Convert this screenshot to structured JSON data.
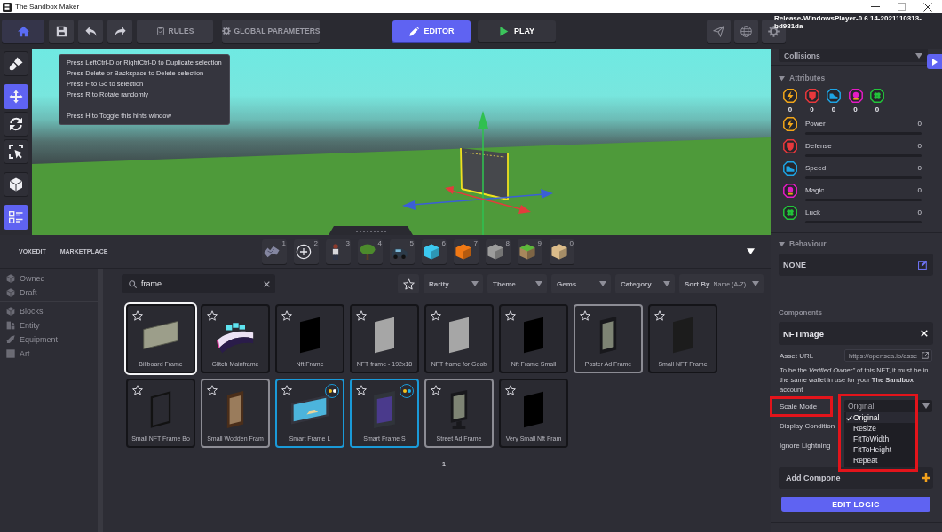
{
  "window": {
    "title": "The Sandbox Maker",
    "build": "Release-WindowsPlayer-0.6.14-2021110313-bd981da"
  },
  "toolbar": {
    "left": [
      {
        "kind": "home"
      },
      {
        "kind": "save"
      },
      {
        "kind": "undo"
      },
      {
        "kind": "redo"
      },
      {
        "kind": "rules",
        "label": "RULES"
      },
      {
        "kind": "gear",
        "label": "GLOBAL PARAMETERS"
      }
    ],
    "modes": [
      {
        "kind": "edit",
        "label": "EDITOR",
        "selected": true
      },
      {
        "kind": "play",
        "label": "PLAY",
        "selected": false
      }
    ],
    "right": [
      {
        "kind": "send"
      },
      {
        "kind": "globe"
      },
      {
        "kind": "settings"
      }
    ]
  },
  "tools": [
    [
      {
        "kind": "brush",
        "selected": false
      }
    ],
    [
      {
        "kind": "move",
        "selected": true
      },
      {
        "kind": "rotate",
        "selected": false
      },
      {
        "kind": "select",
        "selected": false
      }
    ],
    [
      {
        "kind": "cube",
        "selected": false
      }
    ],
    [
      {
        "kind": "hints",
        "selected": true
      }
    ]
  ],
  "hints": {
    "lines": [
      "Press LeftCtrl-D or RightCtrl-D to Duplicate selection",
      "Press Delete or Backspace to Delete selection",
      "Press F to Go to selection",
      "Press R to Rotate randomly"
    ],
    "footer": "Press H to Toggle this hints window"
  },
  "library": {
    "tabs": [
      {
        "label": "VOXEDIT"
      },
      {
        "label": "MARKETPLACE"
      }
    ],
    "quickbar": [
      {
        "number": "1",
        "kind": "creature"
      },
      {
        "number": "2",
        "kind": "add"
      },
      {
        "number": "3",
        "kind": "figure"
      },
      {
        "number": "4",
        "kind": "tree"
      },
      {
        "number": "5",
        "kind": "vehicle"
      },
      {
        "number": "6",
        "kind": "block",
        "color": "#3cc8f0"
      },
      {
        "number": "7",
        "kind": "block",
        "color": "#f07814"
      },
      {
        "number": "8",
        "kind": "block",
        "color": "#9c9c9c"
      },
      {
        "number": "9",
        "kind": "grass",
        "color": "#5cb83a"
      },
      {
        "number": "0",
        "kind": "block",
        "color": "#dcbc8a"
      }
    ],
    "categories": [
      {
        "items": [
          {
            "label": "Owned",
            "kind": "cube",
            "selected": false
          },
          {
            "label": "Draft",
            "kind": "cube",
            "selected": false
          }
        ]
      },
      {
        "items": [
          {
            "label": "Blocks",
            "kind": "cube",
            "selected": false
          },
          {
            "label": "Entity",
            "kind": "entity",
            "selected": false
          },
          {
            "label": "Equipment",
            "kind": "equipment",
            "selected": false
          },
          {
            "label": "Art",
            "kind": "art",
            "selected": false
          }
        ]
      }
    ],
    "search": {
      "value": "frame"
    },
    "filters": [
      {
        "label": "Rarity"
      },
      {
        "label": "Theme"
      },
      {
        "label": "Gems"
      },
      {
        "label": "Category"
      },
      {
        "label": "Sort By",
        "value": "Name (A-Z)"
      }
    ],
    "cards": [
      {
        "label": "Billboard Frame",
        "selected": true,
        "color": "#141418",
        "art": {
          "kind": "billboard",
          "color": "#9c9e8a"
        }
      },
      {
        "label": "Glitch Mainframe",
        "selected": false,
        "color": "#141418",
        "art": {
          "kind": "mainframe",
          "color": "#ece2f4"
        }
      },
      {
        "label": "Nft Frame",
        "selected": false,
        "color": "#141418",
        "art": {
          "kind": "panel",
          "color": "#000000"
        }
      },
      {
        "label": "NFT frame - 192x18",
        "selected": false,
        "color": "#141418",
        "art": {
          "kind": "panel",
          "color": "#a6a6a6"
        }
      },
      {
        "label": "NFT frame for Goob",
        "selected": false,
        "color": "#141418",
        "art": {
          "kind": "panel",
          "color": "#a6a6a6"
        }
      },
      {
        "label": "Nft Frame Small",
        "selected": false,
        "color": "#141418",
        "art": {
          "kind": "panel",
          "color": "#000000"
        }
      },
      {
        "label": "Poster Ad Frame",
        "selected": false,
        "color": "#8c8c94",
        "art": {
          "kind": "poster",
          "color": "#7e8474"
        }
      },
      {
        "label": "Small NFT Frame",
        "selected": false,
        "color": "#141418",
        "art": {
          "kind": "panel",
          "color": "#1c1c1c"
        }
      },
      {
        "label": "Small NFT Frame Bo",
        "selected": false,
        "color": "#141418",
        "art": {
          "kind": "outline",
          "color": "#121212"
        }
      },
      {
        "label": "Small Wodden Fram",
        "selected": false,
        "color": "#8c8c94",
        "art": {
          "kind": "wood",
          "color": "#9a7c5c"
        }
      },
      {
        "label": "Smart Frame L",
        "selected": false,
        "color": "#1a9ad8",
        "art": {
          "kind": "landscape",
          "color": "#4cb4dc"
        },
        "badge": [
          {
            "color": "#f2c21c"
          },
          {
            "color": "#ffffff"
          }
        ]
      },
      {
        "label": "Smart Frame S",
        "selected": false,
        "color": "#1a9ad8",
        "art": {
          "kind": "portrait",
          "color": "#4a3a8c"
        },
        "badge": [
          {
            "color": "#f2c21c"
          },
          {
            "color": "#18b4f0"
          }
        ]
      },
      {
        "label": "Street Ad Frame",
        "selected": false,
        "color": "#8c8c94",
        "art": {
          "kind": "sign",
          "color": "#7e8474"
        }
      },
      {
        "label": "Very Small Nft Fram",
        "selected": false,
        "color": "#141418",
        "art": {
          "kind": "panel",
          "color": "#000000"
        }
      }
    ],
    "page": "1"
  },
  "inspector": {
    "collisions": {
      "label": "Collisions"
    },
    "attributes": {
      "title": "Attributes",
      "expanded": true,
      "totals": [
        {
          "kind": "power",
          "value": "0",
          "color": "#f2a61a"
        },
        {
          "kind": "defense",
          "value": "0",
          "color": "#e8383c"
        },
        {
          "kind": "speed",
          "value": "0",
          "color": "#1ea4e4"
        },
        {
          "kind": "magic",
          "value": "0",
          "color": "#e41cc4"
        },
        {
          "kind": "luck",
          "value": "0",
          "color": "#22c43a"
        }
      ],
      "stats": [
        {
          "kind": "power",
          "name": "Power",
          "value": "0",
          "level": 0,
          "color": "#f2a61a"
        },
        {
          "kind": "defense",
          "name": "Defense",
          "value": "0",
          "level": 0,
          "color": "#e8383c"
        },
        {
          "kind": "speed",
          "name": "Speed",
          "value": "0",
          "level": 0,
          "color": "#1ea4e4"
        },
        {
          "kind": "magic",
          "name": "Magic",
          "value": "0",
          "level": 0,
          "color": "#e41cc4"
        },
        {
          "kind": "luck",
          "name": "Luck",
          "value": "0",
          "level": 0,
          "color": "#22c43a"
        }
      ]
    },
    "behaviour": {
      "title": "Behaviour",
      "expanded": true,
      "value": "NONE"
    },
    "components": {
      "title": "Components",
      "items": [
        {
          "name": "NFTImage",
          "fields": [
            {
              "kind": "url",
              "label": "Asset URL",
              "value": "https://opensea.io/asse"
            },
            {
              "kind": "note",
              "text": "To be the *Verified Owner\"* of this NFT, it must be in the same wallet in use for your **The Sandbox** account"
            },
            {
              "kind": "dropdown",
              "label": "Scale Mode",
              "value": "Original",
              "label_highlighted": true,
              "menu_highlighted": true,
              "open": true,
              "options": [
                {
                  "label": "Original",
                  "selected": true
                },
                {
                  "label": "Resize",
                  "selected": false
                },
                {
                  "label": "FitToWidth",
                  "selected": false
                },
                {
                  "label": "FitToHeight",
                  "selected": false
                },
                {
                  "label": "Repeat",
                  "selected": false
                }
              ]
            },
            {
              "kind": "plain",
              "label": "Display Condition"
            },
            {
              "kind": "plain",
              "label": "Ignore Lightning"
            }
          ]
        }
      ],
      "add_label": "Add Compone",
      "button": "EDIT LOGIC"
    }
  }
}
